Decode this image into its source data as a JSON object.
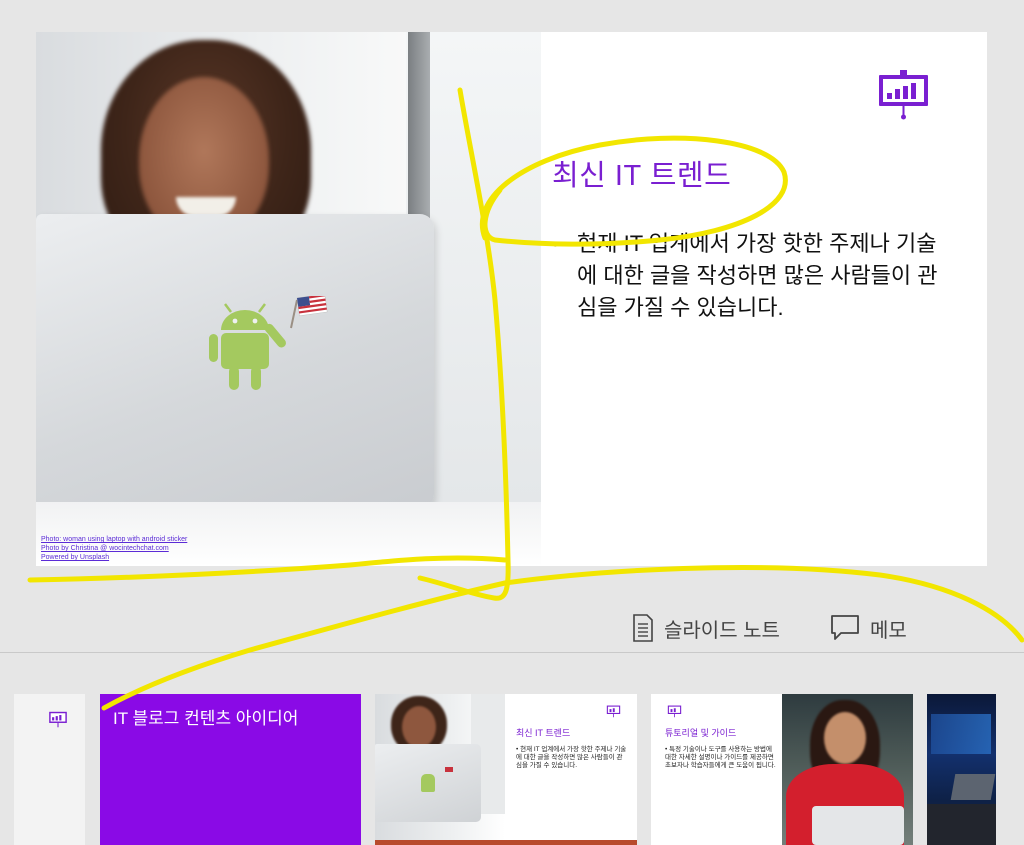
{
  "slide": {
    "title": "최신 IT 트렌드",
    "bullets": [
      "현재 IT 업계에서 가장 핫한 주제나 기술에 대한 글을 작성하면 많은 사람들이 관심을 가질 수 있습니다."
    ],
    "photo_credit": [
      "Photo: woman using laptop with android sticker",
      "Photo by Christina @ wocintechchat.com",
      "Powered by Unsplash"
    ],
    "icon": "presentation-chart-icon"
  },
  "toolbar": {
    "notes_label": "슬라이드 노트",
    "notes_icon": "notes-page-icon",
    "memo_label": "메모",
    "memo_icon": "comment-icon"
  },
  "thumbnails": [
    {
      "index": 1,
      "title": "",
      "icon": "presentation-chart-icon"
    },
    {
      "index": 2,
      "title": "IT 블로그 컨텐츠 아이디어"
    },
    {
      "index": 3,
      "title": "최신 IT 트렌드",
      "body": "현재 IT 업계에서 가장 핫한 주제나 기술에 대한 글을 작성하면 많은 사람들이 관심을 가질 수 있습니다."
    },
    {
      "index": 4,
      "title": "튜토리얼 및 가이드",
      "body": "특정 기술이나 도구를 사용하는 방법에 대한 자세한 설명이나 가이드를 제공하면 초보자나 학습자들에게 큰 도움이 됩니다."
    },
    {
      "index": 5,
      "title": ""
    }
  ],
  "colors": {
    "accent": "#7a1fd1",
    "title_slide_bg": "#8a0ae6",
    "ink": "#f2e600",
    "canvas_bg": "#e6e6e6"
  }
}
